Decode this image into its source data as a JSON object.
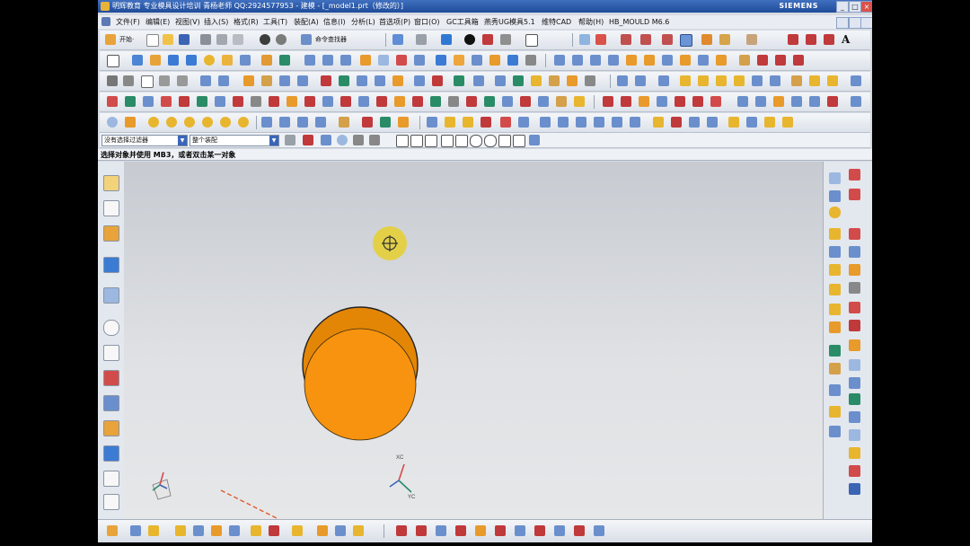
{
  "window": {
    "title": "明辉教育 专业模具设计培训 青杨老师  QQ:2924577953 - 建模 - [_model1.prt（修改的）]",
    "brand": "SIEMENS",
    "buttons": [
      "_",
      "□",
      "×"
    ]
  },
  "menu": [
    "文件(F)",
    "编辑(E)",
    "视图(V)",
    "插入(S)",
    "格式(R)",
    "工具(T)",
    "装配(A)",
    "信息(I)",
    "分析(L)",
    "首选项(P)",
    "窗口(O)",
    "GC工具箱",
    "燕秀UG模具5.1",
    "维特CAD",
    "帮助(H)",
    "HB_MOULD M6.6"
  ],
  "toolbar": {
    "start_label": "开始·",
    "command_finder_label": "命令查找器"
  },
  "filter": {
    "selection_filter": "没有选择过滤器",
    "scope": "整个装配"
  },
  "status_text": "选择对象并使用 MB3，或者双击某一对象",
  "viewport": {
    "model_color": "#f7930e",
    "triad_labels": [
      "XC",
      "YC"
    ]
  }
}
